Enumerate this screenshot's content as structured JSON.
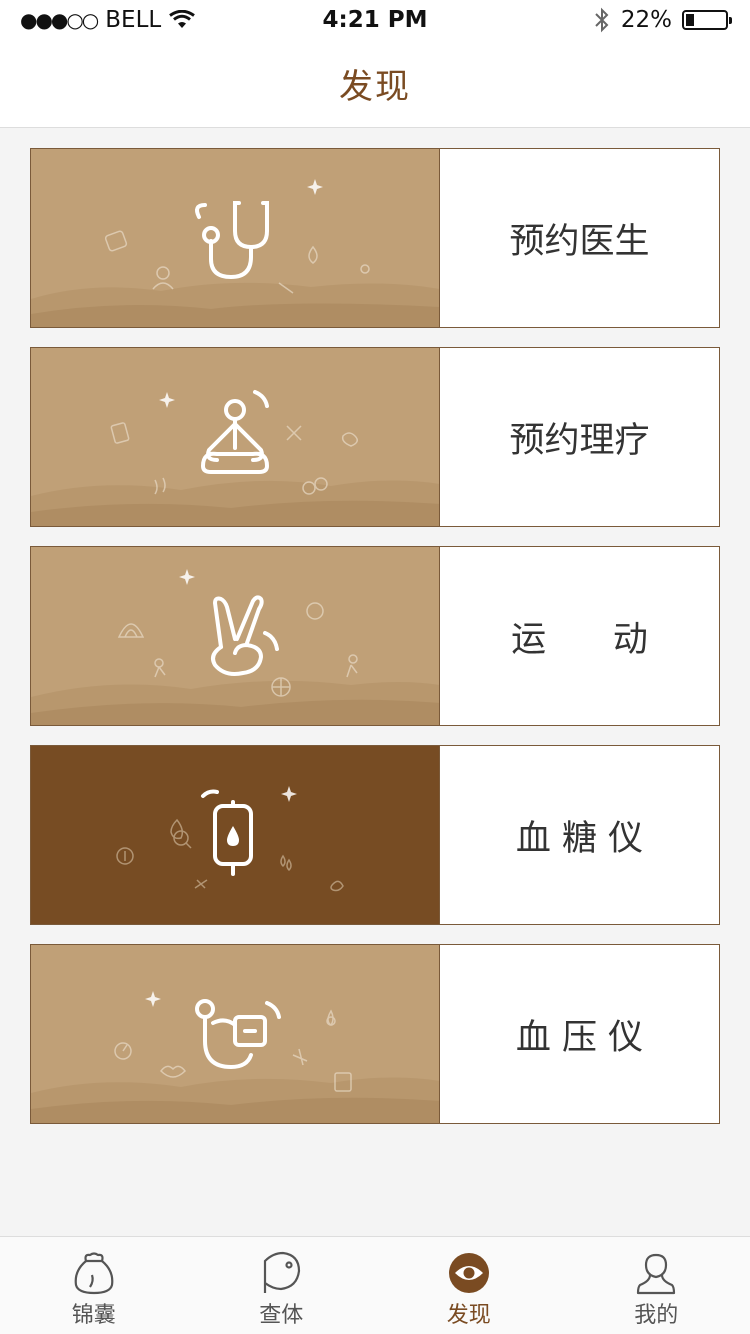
{
  "status": {
    "carrier": "BELL",
    "time": "4:21 PM",
    "battery": "22%",
    "battery_level": 0.22,
    "signal": "●●●○○"
  },
  "header": {
    "title": "发现"
  },
  "cards": [
    {
      "label": "预约医生",
      "icon": "stethoscope-icon",
      "active": false
    },
    {
      "label": "预约理疗",
      "icon": "meditation-icon",
      "active": false
    },
    {
      "label": "运      动",
      "icon": "victory-hand-icon",
      "active": false
    },
    {
      "label": "血 糖 仪",
      "icon": "iv-bag-icon",
      "active": true
    },
    {
      "label": "血 压 仪",
      "icon": "blood-pressure-cuff-icon",
      "active": false
    }
  ],
  "tabs": [
    {
      "label": "锦囊",
      "icon": "pouch-icon",
      "active": false
    },
    {
      "label": "查体",
      "icon": "checkup-icon",
      "active": false
    },
    {
      "label": "发现",
      "icon": "eye-icon",
      "active": true
    },
    {
      "label": "我的",
      "icon": "user-icon",
      "active": false
    }
  ],
  "colors": {
    "accent": "#7a4b22",
    "card_bg": "#c0a077",
    "card_active_bg": "#774c23"
  }
}
